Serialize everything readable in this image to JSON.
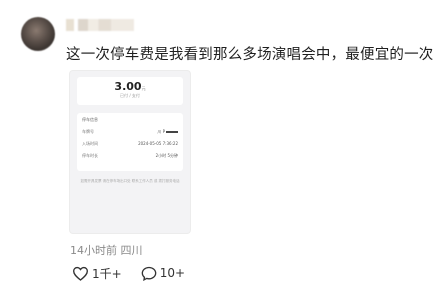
{
  "post": {
    "username": "",
    "text": "这一次停车费是我看到那么多场演唱会中，最便宜的一次",
    "meta": "14小时前 四川",
    "likes": "1千+",
    "comments": "10+"
  },
  "screenshot": {
    "amount": "3.00",
    "amount_unit": "元",
    "amount_sub": "已付 / 支付",
    "card_title": "停车信息",
    "rows": [
      {
        "key": "车牌号",
        "value": "川 P"
      },
      {
        "key": "入场时间",
        "value": "2024-05-05 7:36:22"
      },
      {
        "key": "停车时长",
        "value": "2小时 5分钟"
      }
    ],
    "footnote": "如需开具发票 请在停车场出口处 联系工作人员 或 拨打服务电话"
  },
  "colors": {
    "text": "#1f1f1f",
    "meta": "#8a8a8a",
    "card_bg": "#f3f3f5"
  },
  "icons": {
    "like": "heart-icon",
    "comment": "comment-bubble-icon"
  }
}
